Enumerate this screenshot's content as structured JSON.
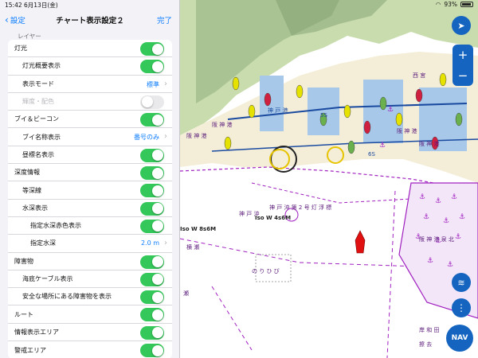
{
  "status_bar": {
    "time": "15:42",
    "date": "6月13日(金)",
    "battery": "93%"
  },
  "nav": {
    "back_label": "設定",
    "title": "チャート表示設定２",
    "done_label": "完了"
  },
  "section_header": "レイヤー",
  "rows": [
    {
      "label": "灯光",
      "indent": 0,
      "control": "toggle",
      "on": true
    },
    {
      "label": "灯光概要表示",
      "indent": 1,
      "control": "toggle",
      "on": true
    },
    {
      "label": "表示モード",
      "indent": 1,
      "control": "value",
      "value": "標準"
    },
    {
      "label": "輝度・配色",
      "indent": 1,
      "control": "toggle",
      "on": false,
      "disabled": true
    },
    {
      "label": "ブイ＆ビーコン",
      "indent": 0,
      "control": "toggle",
      "on": true
    },
    {
      "label": "ブイ名称表示",
      "indent": 1,
      "control": "value",
      "value": "番号のみ"
    },
    {
      "label": "昼標名表示",
      "indent": 1,
      "control": "toggle",
      "on": true
    },
    {
      "label": "深度情報",
      "indent": 0,
      "control": "toggle",
      "on": true
    },
    {
      "label": "等深線",
      "indent": 1,
      "control": "toggle",
      "on": true
    },
    {
      "label": "水深表示",
      "indent": 1,
      "control": "toggle",
      "on": true
    },
    {
      "label": "指定水深赤色表示",
      "indent": 2,
      "control": "toggle",
      "on": true
    },
    {
      "label": "指定水深",
      "indent": 2,
      "control": "value",
      "value": "2.0 m"
    },
    {
      "label": "障害物",
      "indent": 0,
      "control": "toggle",
      "on": true
    },
    {
      "label": "海底ケーブル表示",
      "indent": 1,
      "control": "toggle",
      "on": true
    },
    {
      "label": "安全な場所にある障害物を表示",
      "indent": 1,
      "control": "toggle",
      "on": true
    },
    {
      "label": "ルート",
      "indent": 0,
      "control": "toggle",
      "on": true
    },
    {
      "label": "情報表示エリア",
      "indent": 0,
      "control": "toggle",
      "on": true
    },
    {
      "label": "警戒エリア",
      "indent": 0,
      "control": "toggle",
      "on": true
    }
  ],
  "map": {
    "labels": {
      "hanshin_1": "阪 神 港",
      "hanshin_2": "阪 神 港",
      "hanshin_3": "阪 神 港",
      "hanshin_4": "阪 神 港",
      "kobe_buoy": "神 戸 沖 第 2 号 灯 浮 標",
      "kobe_oki": "神 戸 沖",
      "iso1": "Iso W 8s6M",
      "iso2": "Iso W 4s6M",
      "norihibi": "の り ひ び",
      "yoko": "横 瀬",
      "se": "瀬",
      "kishiwada": "岸 和 田",
      "kaizuka": "擦 去",
      "hanshin_ko": "阪 神 港 泉 北",
      "nishinomiya": "西 宮",
      "kobe_dist": "神 戸 港",
      "b1": "5S",
      "b2": "6S"
    },
    "buttons": {
      "nav": "NAV",
      "zoom_in": "+",
      "zoom_out": "−"
    },
    "colors": {
      "land": "#b8d9a8",
      "water_dredged": "#a7c8e8",
      "boundary": "#a020c0",
      "vessel": "#e01010",
      "button": "#1565c0"
    }
  }
}
